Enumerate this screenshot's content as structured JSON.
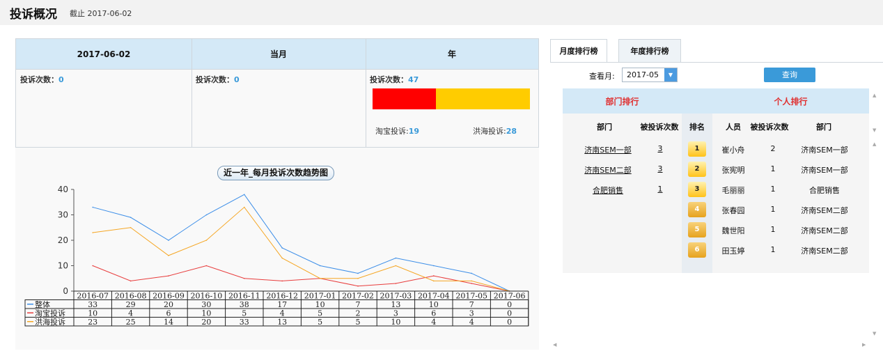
{
  "header": {
    "title": "投诉概况",
    "subtitle": "截止 2017-06-02"
  },
  "summary": {
    "columns": [
      {
        "label": "2017-06-02",
        "count_label": "投诉次数：",
        "count": "0"
      },
      {
        "label": "当月",
        "count_label": "投诉次数：",
        "count": "0"
      },
      {
        "label": "年",
        "count_label": "投诉次数：",
        "count": "47"
      }
    ],
    "year_breakdown": {
      "taobao_label": "淘宝投诉:",
      "taobao": 19,
      "honghai_label": "洪海投诉:",
      "honghai": 28
    }
  },
  "chart_data": {
    "type": "line",
    "title": "近一年_每月投诉次数趋势图",
    "x": [
      "2016-07",
      "2016-08",
      "2016-09",
      "2016-10",
      "2016-11",
      "2016-12",
      "2017-01",
      "2017-02",
      "2017-03",
      "2017-04",
      "2017-05",
      "2017-06"
    ],
    "ylim": [
      0,
      40
    ],
    "yticks": [
      0,
      10,
      20,
      30,
      40
    ],
    "grid": false,
    "legend": "data-table",
    "series": [
      {
        "name": "整体",
        "color": "#3c8ee8",
        "values": [
          33,
          29,
          20,
          30,
          38,
          17,
          10,
          7,
          13,
          10,
          7,
          0
        ]
      },
      {
        "name": "淘宝投诉",
        "color": "#e83c3c",
        "values": [
          10,
          4,
          6,
          10,
          5,
          4,
          5,
          2,
          3,
          6,
          3,
          0
        ]
      },
      {
        "name": "洪海投诉",
        "color": "#f5a623",
        "values": [
          23,
          25,
          14,
          20,
          33,
          13,
          5,
          5,
          10,
          4,
          4,
          0
        ]
      }
    ]
  },
  "ranking": {
    "tabs": [
      {
        "label": "月度排行榜"
      },
      {
        "label": "年度排行榜"
      }
    ],
    "month_label": "查看月:",
    "month_value": "2017-05",
    "query_label": "查询",
    "dept_header": "部门排行",
    "person_header": "个人排行",
    "dept_columns": [
      "部门",
      "被投诉次数"
    ],
    "rank_column": "排名",
    "person_columns": [
      "人员",
      "被投诉次数",
      "部门"
    ],
    "departments": [
      {
        "name": "济南SEM一部",
        "count": "3"
      },
      {
        "name": "济南SEM二部",
        "count": "3"
      },
      {
        "name": "合肥销售",
        "count": "1"
      }
    ],
    "persons": [
      {
        "rank": "1",
        "name": "崔小舟",
        "count": "2",
        "dept": "济南SEM一部"
      },
      {
        "rank": "2",
        "name": "张宪明",
        "count": "1",
        "dept": "济南SEM一部"
      },
      {
        "rank": "3",
        "name": "毛丽丽",
        "count": "1",
        "dept": "合肥销售"
      },
      {
        "rank": "4",
        "name": "张春园",
        "count": "1",
        "dept": "济南SEM二部"
      },
      {
        "rank": "5",
        "name": "魏世阳",
        "count": "1",
        "dept": "济南SEM二部"
      },
      {
        "rank": "6",
        "name": "田玉婷",
        "count": "1",
        "dept": "济南SEM二部"
      }
    ]
  },
  "colors": {
    "accent": "#3a9ad9",
    "header_bg": "#d4e9f7",
    "rank_red": "#e03030",
    "bar_taobao": "#ff0000",
    "bar_honghai": "#ffcc00"
  },
  "icons": {
    "dropdown": "chevron-down-icon",
    "scroll": "scroll-arrow-icon"
  }
}
